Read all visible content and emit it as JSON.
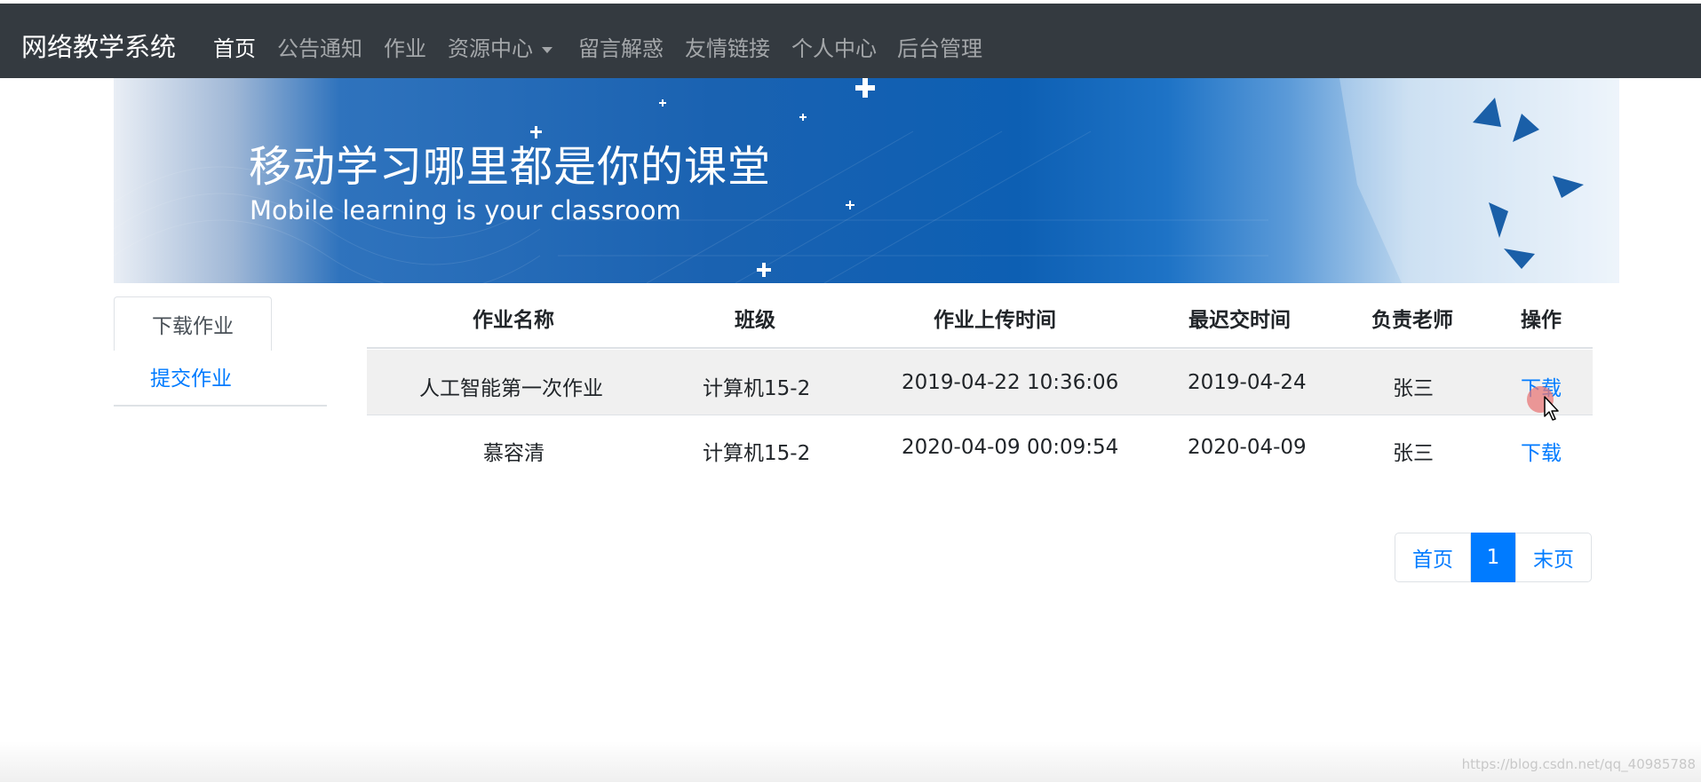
{
  "navbar": {
    "brand": "网络教学系统",
    "items": [
      {
        "label": "首页",
        "active": true
      },
      {
        "label": "公告通知"
      },
      {
        "label": "作业"
      },
      {
        "label": "资源中心",
        "dropdown": true
      },
      {
        "label": "留言解惑"
      },
      {
        "label": "友情链接"
      },
      {
        "label": "个人中心"
      },
      {
        "label": "后台管理"
      }
    ]
  },
  "banner": {
    "title_cn": "移动学习哪里都是你的课堂",
    "title_en": "Mobile learning is your classroom"
  },
  "side_nav": {
    "items": [
      {
        "label": "下载作业",
        "active": true
      },
      {
        "label": "提交作业"
      }
    ]
  },
  "table": {
    "headers": [
      "作业名称",
      "班级",
      "作业上传时间",
      "最迟交时间",
      "负责老师",
      "操作"
    ],
    "rows": [
      [
        "人工智能第一次作业",
        "计算机15-2",
        "2019-04-22 10:36:06",
        "2019-04-24",
        "张三",
        "下载"
      ],
      [
        "慕容清",
        "计算机15-2",
        "2020-04-09 00:09:54",
        "2020-04-09",
        "张三",
        "下载"
      ]
    ]
  },
  "pagination": {
    "first": "首页",
    "current": "1",
    "last": "末页"
  },
  "watermark": "https://blog.csdn.net/qq_40985788",
  "colors": {
    "navbar_bg": "#343a40",
    "link": "#007bff",
    "row_highlight": "#f0f0f0"
  }
}
